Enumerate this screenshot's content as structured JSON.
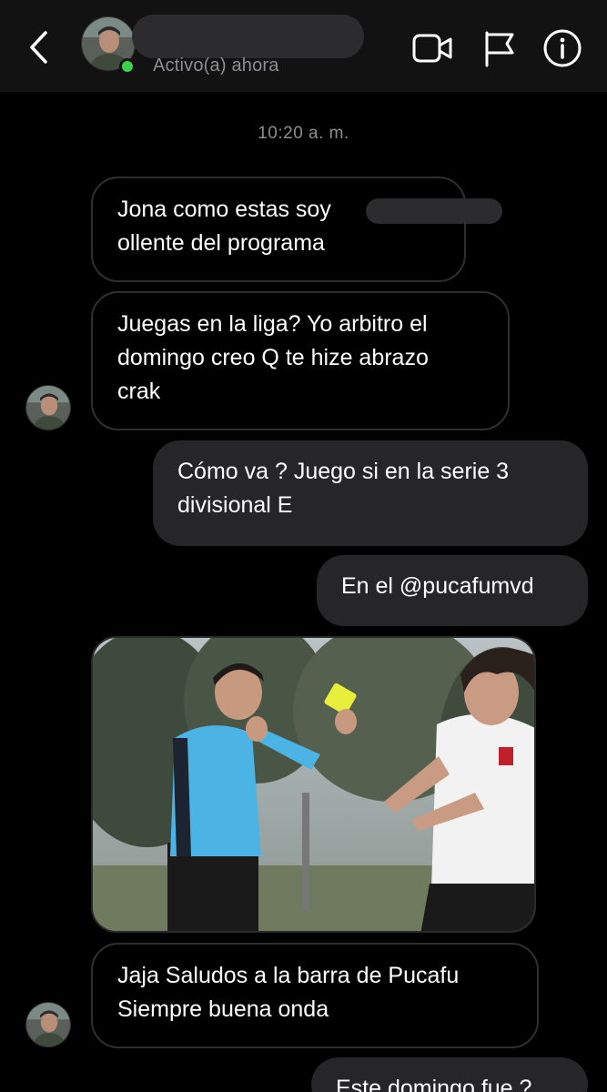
{
  "header": {
    "status": "Activo(a) ahora",
    "icons": [
      "chevron-left-icon",
      "video-camera-icon",
      "flag-icon",
      "info-icon"
    ],
    "online_color": "#3bd14a"
  },
  "chat": {
    "timestamp": "10:20 a. m.",
    "messages": [
      {
        "direction": "in",
        "lines": [
          "Jona como estas soy",
          "ollente del programa"
        ]
      },
      {
        "direction": "in",
        "lines": [
          "Juegas en la liga? Yo arbitro el",
          "domingo creo Q te hize abrazo",
          "crak"
        ]
      },
      {
        "direction": "out",
        "lines": [
          "Cómo va ? Juego si en la serie 3",
          "divisional E"
        ]
      },
      {
        "direction": "out",
        "lines": [
          "En el @pucafumvd"
        ]
      },
      {
        "direction": "in",
        "type": "photo"
      },
      {
        "direction": "in",
        "lines": [
          "Jaja Saludos a la barra de Pucafu",
          "Siempre buena onda"
        ]
      },
      {
        "direction": "out",
        "lines": [
          "Este domingo fue ?"
        ]
      }
    ]
  },
  "colors": {
    "background": "#000000",
    "header_bg": "#121212",
    "outgoing_bubble": "#262628",
    "incoming_border": "#2f2f2f",
    "muted_text": "#8e8e93"
  }
}
